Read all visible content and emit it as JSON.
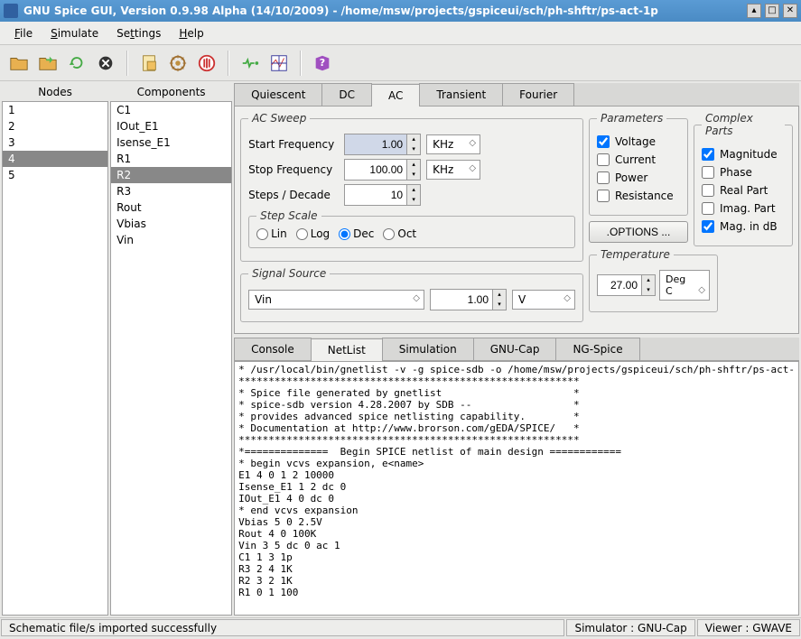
{
  "window": {
    "title": "GNU Spice GUI,  Version 0.9.98 Alpha (14/10/2009)  -  /home/msw/projects/gspiceui/sch/ph-shftr/ps-act-1p"
  },
  "menus": {
    "file": "File",
    "simulate": "Simulate",
    "settings": "Settings",
    "help": "Help"
  },
  "panels": {
    "nodes_label": "Nodes",
    "components_label": "Components"
  },
  "nodes": [
    "1",
    "2",
    "3",
    "4",
    "5"
  ],
  "nodes_selected": 3,
  "components": [
    "C1",
    "IOut_E1",
    "Isense_E1",
    "R1",
    "R2",
    "R3",
    "Rout",
    "Vbias",
    "Vin"
  ],
  "components_selected": 4,
  "sim_tabs": [
    "Quiescent",
    "DC",
    "AC",
    "Transient",
    "Fourier"
  ],
  "sim_tab_active": 2,
  "ac": {
    "sweep_legend": "AC Sweep",
    "start_label": "Start Frequency",
    "start_value": "1.00",
    "start_unit": "KHz",
    "stop_label": "Stop Frequency",
    "stop_value": "100.00",
    "stop_unit": "KHz",
    "steps_label": "Steps / Decade",
    "steps_value": "10",
    "scale_legend": "Step Scale",
    "scale_options": [
      "Lin",
      "Log",
      "Dec",
      "Oct"
    ],
    "scale_selected": 2,
    "signal_legend": "Signal Source",
    "signal_source": "Vin",
    "signal_value": "1.00",
    "signal_unit": "V",
    "params_legend": "Parameters",
    "params": [
      {
        "label": "Voltage",
        "checked": true
      },
      {
        "label": "Current",
        "checked": false
      },
      {
        "label": "Power",
        "checked": false
      },
      {
        "label": "Resistance",
        "checked": false
      }
    ],
    "options_btn": ".OPTIONS ...",
    "complex_legend": "Complex Parts",
    "complex": [
      {
        "label": "Magnitude",
        "checked": true
      },
      {
        "label": "Phase",
        "checked": false
      },
      {
        "label": "Real Part",
        "checked": false
      },
      {
        "label": "Imag. Part",
        "checked": false
      },
      {
        "label": "Mag. in dB",
        "checked": true
      }
    ],
    "temp_legend": "Temperature",
    "temp_value": "27.00",
    "temp_unit": "Deg C"
  },
  "out_tabs": [
    "Console",
    "NetList",
    "Simulation",
    "GNU-Cap",
    "NG-Spice"
  ],
  "out_tab_active": 1,
  "netlist": "* /usr/local/bin/gnetlist -v -g spice-sdb -o /home/msw/projects/gspiceui/sch/ph-shftr/ps-act-\n*********************************************************\n* Spice file generated by gnetlist                      *\n* spice-sdb version 4.28.2007 by SDB --                 *\n* provides advanced spice netlisting capability.        *\n* Documentation at http://www.brorson.com/gEDA/SPICE/   *\n*********************************************************\n*==============  Begin SPICE netlist of main design ============\n* begin vcvs expansion, e<name>\nE1 4 0 1 2 10000\nIsense_E1 1 2 dc 0\nIOut_E1 4 0 dc 0\n* end vcvs expansion\nVbias 5 0 2.5V\nRout 4 0 100K\nVin 3 5 dc 0 ac 1\nC1 1 3 1p\nR3 2 4 1K\nR2 3 2 1K\nR1 0 1 100",
  "status": {
    "msg": "Schematic file/s imported successfully",
    "simulator": "Simulator : GNU-Cap",
    "viewer": "Viewer : GWAVE"
  }
}
